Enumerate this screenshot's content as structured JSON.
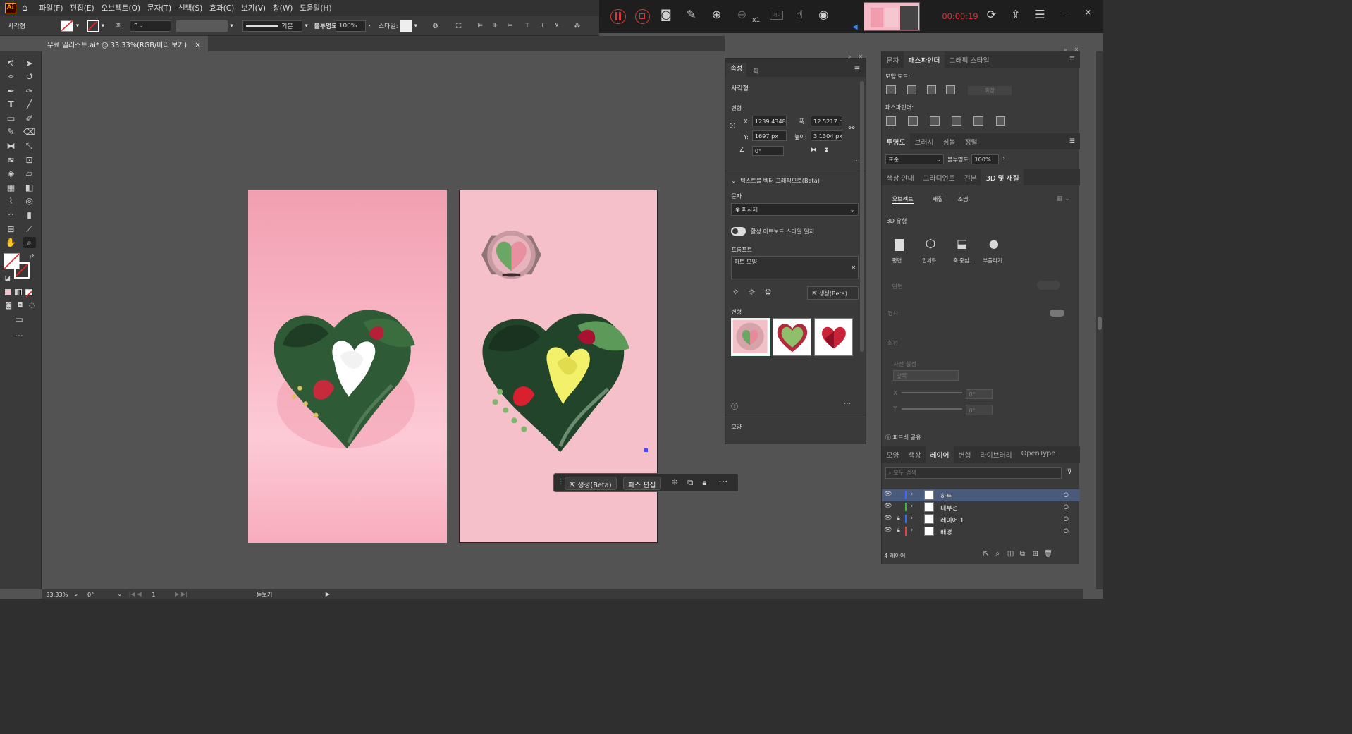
{
  "app": {
    "logo": "Ai"
  },
  "menu": [
    "파일(F)",
    "편집(E)",
    "오브젝트(O)",
    "문자(T)",
    "선택(S)",
    "효과(C)",
    "보기(V)",
    "창(W)",
    "도움말(H)"
  ],
  "recorder": {
    "timer": "00:00:19",
    "zoom_label": "x1",
    "pip": "PIP"
  },
  "control": {
    "object_type": "사각형",
    "stroke_label": "획:",
    "brush_label": "기본",
    "opacity_label": "불투명도:",
    "opacity": "100%",
    "style_label": "스타일:"
  },
  "document": {
    "tab_title": "무료 일러스트.ai* @ 33.33%(RGB/미리 보기)"
  },
  "context_bar": {
    "generate": "생성(Beta)",
    "edit_path": "패스 편집"
  },
  "properties": {
    "tabs": [
      "속성",
      "획"
    ],
    "object": "사각형",
    "transform_title": "변형",
    "x_label": "X:",
    "x": "1239.4348",
    "y_label": "Y:",
    "y": "1697 px",
    "w_label": "폭:",
    "w": "12.5217 p",
    "h_label": "높이:",
    "h": "3.1304 px",
    "angle": "0°",
    "section": "텍스트를 벡터 그래픽으로(Beta)",
    "type_label": "문자",
    "type_value": "피사체",
    "toggle_label": "활성 아트보드 스타일 일치",
    "prompt_label": "프롬프트",
    "prompt": "하트 모양",
    "generate": "생성(Beta)",
    "variations_label": "변형",
    "appearance_label": "모양"
  },
  "pathfinder": {
    "tabs": [
      "문자",
      "패스파인더",
      "그래픽 스타일"
    ],
    "shape_modes": "모양 모드:",
    "expand": "확장",
    "pathfinders": "패스파인더:"
  },
  "transparency": {
    "tabs": [
      "투명도",
      "브러시",
      "심볼",
      "정렬"
    ],
    "mode": "표준",
    "opacity_label": "불투명도:",
    "opacity": "100%"
  },
  "material": {
    "tabs": [
      "색상 안내",
      "그라디언트",
      "견본",
      "3D 및 재질"
    ],
    "subtabs": [
      "오브젝트",
      "재질",
      "조명"
    ],
    "type_label": "3D 유형",
    "types": [
      "평면",
      "입체화",
      "축 중심...",
      "부풀리기"
    ],
    "bevel": "단면",
    "tilt": "경사",
    "rotation": "회전",
    "preset": "사전 설정",
    "preset_value": "앞쪽",
    "x_label": "X",
    "x": "0°",
    "y_label": "Y",
    "y": "0°",
    "feedback": "피드백 공유"
  },
  "layers": {
    "tabs": [
      "모양",
      "색상",
      "레이어",
      "변형",
      "라이브러리",
      "OpenType"
    ],
    "search_placeholder": "모두 검색",
    "items": [
      {
        "name": "하트",
        "color": "#3b6cf5",
        "locked": false,
        "selected": true
      },
      {
        "name": "내부선",
        "color": "#3fb64d",
        "locked": false,
        "selected": false
      },
      {
        "name": "레이어 1",
        "color": "#3b6cf5",
        "locked": true,
        "selected": false
      },
      {
        "name": "배경",
        "color": "#e04545",
        "locked": true,
        "selected": false
      }
    ],
    "count": "4 레이어"
  },
  "status": {
    "zoom": "33.33%",
    "rotate": "0°",
    "artboard": "1",
    "tool": "돋보기"
  }
}
